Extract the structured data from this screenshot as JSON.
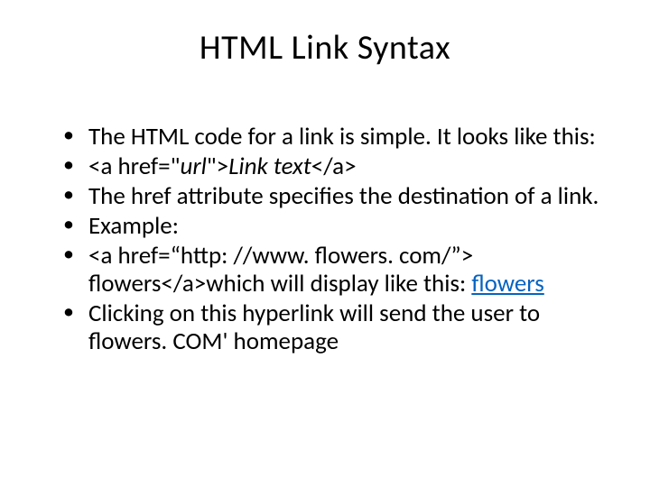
{
  "title": "HTML Link Syntax",
  "bullets": {
    "b1": "The HTML code for a link is simple. It looks like this:",
    "b2_pre": "<a href=\"",
    "b2_url": "url",
    "b2_mid": "\">",
    "b2_linktext": "Link text",
    "b2_post": "</a>",
    "b3": "The href attribute specifies the destination of a link.",
    "b4": "Example:",
    "b5_part1": "<a href=“http: //www. flowers. com/”> flowers</a>which will display like this: ",
    "b5_link": "flowers",
    "b6": "Clicking on this hyperlink will send the user to flowers. COM' homepage"
  }
}
